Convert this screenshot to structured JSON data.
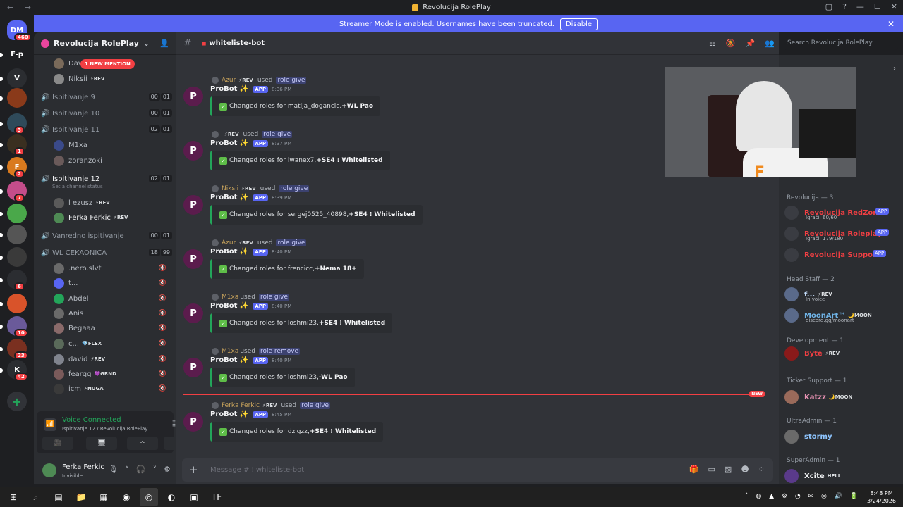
{
  "window": {
    "title": "Revolucija RolePlay",
    "nav": "← →",
    "controls": [
      "▢",
      "?",
      "—",
      "☐",
      "✕"
    ]
  },
  "banner": {
    "text": "Streamer Mode is enabled. Usernames have been truncated.",
    "button": "Disable"
  },
  "guilds": [
    {
      "label": "DM",
      "color": "#5865f2",
      "badge": "460"
    },
    {
      "label": "F-p",
      "color": "#1e1f22",
      "badge": ""
    },
    {
      "label": "V",
      "color": "#2b2d31",
      "badge": ""
    },
    {
      "label": "",
      "color": "#8a3a1a",
      "badge": ""
    },
    {
      "label": "",
      "color": "#2f4a5a",
      "badge": "3"
    },
    {
      "label": "",
      "color": "#3a2f20",
      "badge": "1"
    },
    {
      "label": "F",
      "color": "#d97a1e",
      "badge": "2"
    },
    {
      "label": "",
      "color": "#c44d8a",
      "badge": "7"
    },
    {
      "label": "",
      "color": "#4aa84a",
      "badge": ""
    },
    {
      "label": "",
      "color": "#555555",
      "badge": ""
    },
    {
      "label": "",
      "color": "#3a3a3a",
      "badge": ""
    },
    {
      "label": "",
      "color": "#2b2d31",
      "badge": "6"
    },
    {
      "label": "",
      "color": "#d9532a",
      "badge": ""
    },
    {
      "label": "",
      "color": "#6a5a9a",
      "badge": "10"
    },
    {
      "label": "",
      "color": "#7a3020",
      "badge": "23"
    },
    {
      "label": "K",
      "color": "#2b2d31",
      "badge": "42"
    }
  ],
  "server": {
    "name": "Revolucija RolePlay",
    "mention": "1 NEW MENTION"
  },
  "channels": {
    "rows": [
      {
        "type": "member",
        "name": "Davi",
        "tag": "",
        "color": "#7a6a5a"
      },
      {
        "type": "member",
        "name": "Niksii",
        "tag": "⚡REV",
        "color": "#8a8a8a"
      },
      {
        "type": "voice",
        "name": "Ispitivanje 9",
        "c1": "00",
        "c2": "01"
      },
      {
        "type": "voice",
        "name": "Ispitivanje 10",
        "c1": "00",
        "c2": "01"
      },
      {
        "type": "voice",
        "name": "Ispitivanje 11",
        "c1": "02",
        "c2": "01"
      },
      {
        "type": "member",
        "name": "M1xa",
        "tag": "",
        "color": "#3a4a8a"
      },
      {
        "type": "member",
        "name": "zoranzoki",
        "tag": "",
        "color": "#6a5a5a"
      },
      {
        "type": "voice-active",
        "name": "Ispitivanje 12",
        "c1": "02",
        "c2": "01",
        "status": "Set a channel status"
      },
      {
        "type": "member",
        "name": "l ezusz",
        "tag": "⚡REV",
        "color": "#5a5a5a"
      },
      {
        "type": "member",
        "name": "Ferka Ferkic",
        "tag": "⚡REV",
        "color": "#4e8a54",
        "bright": true
      },
      {
        "type": "voice",
        "name": "Vanredno ispitivanje",
        "c1": "00",
        "c2": "01"
      },
      {
        "type": "voice",
        "name": "WL CEKAONICA",
        "c1": "18",
        "c2": "99"
      },
      {
        "type": "member",
        "name": ".nero.slvt",
        "tag": "",
        "color": "#6a6a6a"
      },
      {
        "type": "member",
        "name": "t...",
        "tag": "",
        "color": "#5865f2"
      },
      {
        "type": "member",
        "name": "Abdel",
        "tag": "",
        "color": "#23a55a"
      },
      {
        "type": "member",
        "name": "Anis",
        "tag": "",
        "color": "#6a6a6a"
      },
      {
        "type": "member",
        "name": "Begaaa",
        "tag": "",
        "color": "#8a6a6a"
      },
      {
        "type": "member",
        "name": "c...",
        "tag": "💎FLEX",
        "color": "#5a6a5a"
      },
      {
        "type": "member",
        "name": "david",
        "tag": "⚡REV",
        "color": "#80848e"
      },
      {
        "type": "member",
        "name": "fearqq",
        "tag": "💜GRND",
        "color": "#7a5a5a"
      },
      {
        "type": "member",
        "name": "icm",
        "tag": "⚡NUGA",
        "color": "#3a3a3a"
      }
    ]
  },
  "voice": {
    "title": "Voice Connected",
    "sub": "Ispitivanje 12 / Revolucija RolePlay",
    "buttons": [
      "🎥",
      "🖥",
      "⁘",
      "✦"
    ]
  },
  "user": {
    "name": "Ferka Ferkic",
    "status": "Invisible",
    "controls": [
      "🎙",
      "˅",
      "🎧",
      "˅",
      "⚙"
    ]
  },
  "channel": {
    "name": "whiteliste-bot",
    "search": "Search Revolucija RolePlay"
  },
  "messages": [
    {
      "user": "Azur",
      "tag": "⚡REV",
      "cmd": "role give",
      "bot": "ProBot",
      "app": "APP",
      "time": "8:36 PM",
      "text": "Changed roles for matija_dogancic, ",
      "bold": "+WL Pao"
    },
    {
      "user": "",
      "tag": "⚡REV",
      "cmd": "role give",
      "bot": "ProBot",
      "app": "APP",
      "time": "8:37 PM",
      "text": "Changed roles for iwanex7, ",
      "bold": "+SE4 ⁞ Whitelisted"
    },
    {
      "user": "Niksii",
      "tag": "⚡REV",
      "cmd": "role give",
      "bot": "ProBot",
      "app": "APP",
      "time": "8:39 PM",
      "text": "Changed roles for sergej0525_40898, ",
      "bold": "+SE4 ⁞ Whitelisted"
    },
    {
      "user": "Azur",
      "tag": "⚡REV",
      "cmd": "role give",
      "bot": "ProBot",
      "app": "APP",
      "time": "8:40 PM",
      "text": "Changed roles for frencicc, ",
      "bold": "+Nema 18+"
    },
    {
      "user": "M1xa",
      "tag": "",
      "cmd": "role give",
      "bot": "ProBot",
      "app": "APP",
      "time": "8:40 PM",
      "text": "Changed roles for loshmi23, ",
      "bold": "+SE4 ⁞ Whitelisted"
    },
    {
      "user": "M1xa",
      "tag": "",
      "cmd": "role remove",
      "bot": "ProBot",
      "app": "APP",
      "time": "8:40 PM",
      "text": "Changed roles for loshmi23, ",
      "bold": "-WL Pao"
    },
    {
      "user": "Ferka Ferkic",
      "tag": "⚡REV",
      "cmd": "role give",
      "bot": "ProBot",
      "app": "APP",
      "time": "8:45 PM",
      "text": "Changed roles for dzigzz, ",
      "bold": "+SE4 ⁞ Whitelisted"
    }
  ],
  "used": "used",
  "new_label": "NEW",
  "composer": {
    "placeholder": "Message # ⁞ whiteliste-bot"
  },
  "members": {
    "g1": "Revolucija — 3",
    "revolucija": [
      {
        "name": "Revolucija RedZone",
        "sub": "Igrači: 60/60",
        "color": "#f23f43"
      },
      {
        "name": "Revolucija Roleplay",
        "sub": "Igrači: 179/180",
        "color": "#f23f43"
      },
      {
        "name": "Revolucija Support",
        "sub": "",
        "color": "#f23f43"
      }
    ],
    "g2": "Head Staff — 2",
    "staff": [
      {
        "name": "f...",
        "tag": "⚡REV",
        "sub": "In voice",
        "color": "#c7e0ff"
      },
      {
        "name": "MoonArt™",
        "tag": "🌙MOON",
        "sub": "discord.gg/moonart",
        "color": "#6fb3e6"
      }
    ],
    "g3": "Development — 1",
    "dev": {
      "name": "Byte",
      "tag": "⚡REV",
      "color": "#f23f43"
    },
    "g4": "Ticket Support — 1",
    "ticket": {
      "name": "Katzz",
      "tag": "🌙MOON",
      "color": "#e892b3"
    },
    "g5": "UltraAdmin — 1",
    "ultra": {
      "name": "stormy",
      "color": "#8ec5ff"
    },
    "g6": "SuperAdmin — 1",
    "superadmin": {
      "name": "Xcite",
      "tag": "HELL",
      "color": "#f2f3f5"
    }
  },
  "taskbar": {
    "icons": [
      "⊞",
      "⌕",
      "▤",
      "📁",
      "▦",
      "◉",
      "◎",
      "◐",
      "▣",
      "TF"
    ],
    "time": "8:48 PM",
    "date": "3/24/2026"
  }
}
